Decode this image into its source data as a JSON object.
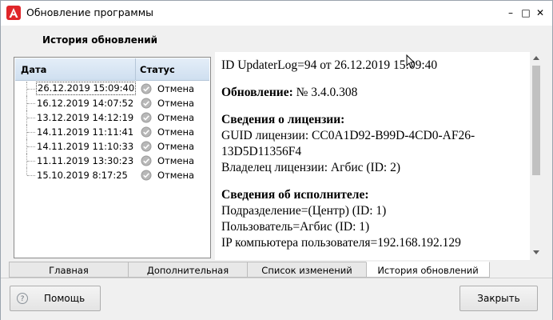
{
  "window": {
    "title": "Обновление программы",
    "minimize_glyph": "–",
    "maximize_glyph": "□",
    "close_glyph": "✕",
    "logo_icon": "app-logo-a-icon",
    "logo_color": "#e0262a"
  },
  "section_caption": "История обновлений",
  "table": {
    "col_date": "Дата",
    "col_status": "Статус",
    "rows": [
      {
        "date": "26.12.2019 15:09:40",
        "status": "Отмена"
      },
      {
        "date": "16.12.2019 14:07:52",
        "status": "Отмена"
      },
      {
        "date": "13.12.2019 14:12:19",
        "status": "Отмена"
      },
      {
        "date": "14.11.2019 11:11:41",
        "status": "Отмена"
      },
      {
        "date": "14.11.2019 11:10:33",
        "status": "Отмена"
      },
      {
        "date": "11.11.2019 13:30:23",
        "status": "Отмена"
      },
      {
        "date": "15.10.2019 8:17:25",
        "status": "Отмена"
      }
    ],
    "status_icon": "check-circle-icon"
  },
  "details": {
    "log_line": "ID UpdaterLog=94 от 26.12.2019 15:09:40",
    "update_label": "Обновление:",
    "update_value": "№ 3.4.0.308",
    "license_header": "Сведения о лицензии:",
    "license_guid": "GUID лицензии: CC0A1D92-B99D-4CD0-AF26-13D5D11356F4",
    "license_owner": "Владелец лицензии: Агбис (ID: 2)",
    "executor_header": "Сведения об исполнителе:",
    "executor_department": "Подразделение=(Центр) (ID: 1)",
    "executor_user": "Пользователь=Агбис (ID: 1)",
    "executor_ip": "IP компьютера пользователя=192.168.192.129"
  },
  "tabs": [
    {
      "label": "Главная"
    },
    {
      "label": "Дополнительная"
    },
    {
      "label": "Список изменений"
    },
    {
      "label": "История обновлений",
      "active": true
    }
  ],
  "buttons": {
    "help": "Помощь",
    "help_icon": "question-circle-icon",
    "close": "Закрыть"
  }
}
